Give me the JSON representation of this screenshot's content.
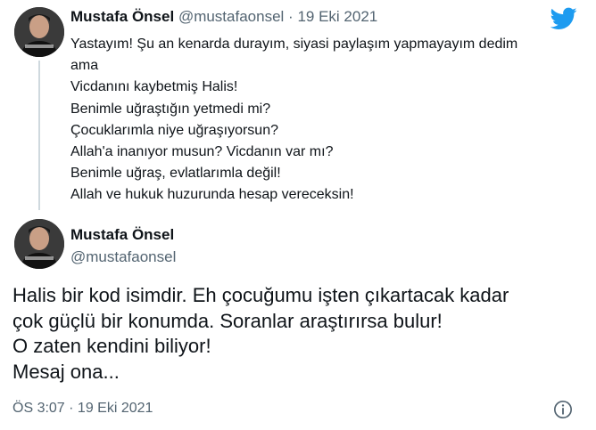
{
  "tweet_parent": {
    "name": "Mustafa Önsel",
    "handle": "@mustafaonsel",
    "separator": "·",
    "date": "19 Eki 2021",
    "lines": [
      "Yastayım! Şu an kenarda durayım, siyasi paylaşım yapmayayım dedim",
      "ama",
      "Vicdanını kaybetmiş Halis!",
      "Benimle uğraştığın yetmedi mi?",
      "Çocuklarımla niye uğraşıyorsun?",
      "Allah'a inanıyor musun? Vicdanın var mı?",
      "Benimle uğraş, evlatlarımla değil!",
      "Allah ve hukuk huzurunda hesap vereceksin!"
    ]
  },
  "tweet_main": {
    "name": "Mustafa Önsel",
    "handle": "@mustafaonsel",
    "lines": [
      "Halis bir kod isimdir. Eh çocuğumu işten çıkartacak kadar",
      "çok güçlü bir konumda. Soranlar araştırırsa bulur!",
      "O zaten kendini biliyor!",
      "Mesaj ona..."
    ],
    "timestamp": "ÖS 3:07 · 19 Eki 2021"
  },
  "icons": {
    "brand": "twitter-bird-icon",
    "info": "info-icon"
  },
  "colors": {
    "twitter_blue": "#1d9bf0",
    "text": "#0f1419",
    "muted": "#536471",
    "thread_line": "#cfd9de"
  }
}
